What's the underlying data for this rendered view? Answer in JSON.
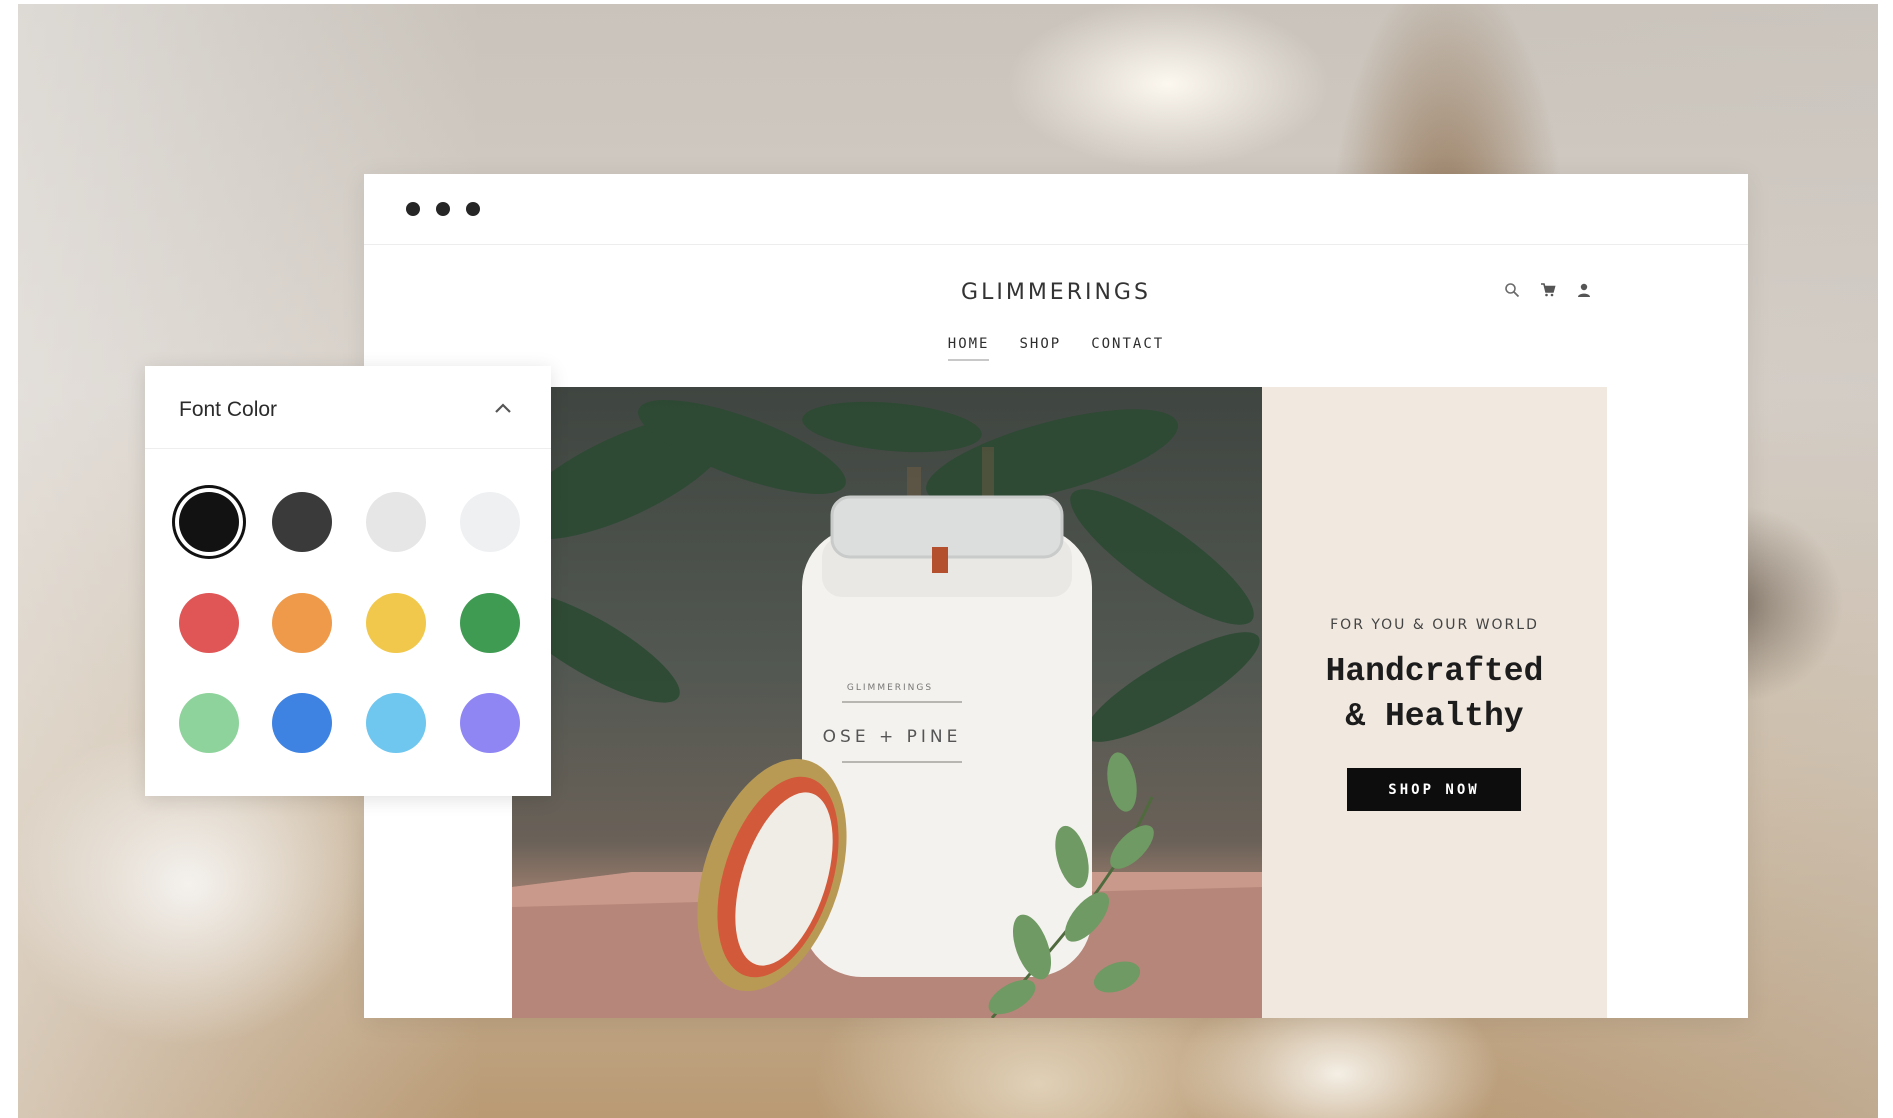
{
  "window": {
    "controls": [
      "dot",
      "dot",
      "dot"
    ]
  },
  "site": {
    "brand": "GLIMMERINGS",
    "header_icons": [
      "search-icon",
      "cart-icon",
      "user-icon"
    ],
    "nav": [
      {
        "label": "HOME",
        "active": true
      },
      {
        "label": "SHOP",
        "active": false
      },
      {
        "label": "CONTACT",
        "active": false
      }
    ]
  },
  "hero": {
    "jar_label_brand": "GLIMMERINGS",
    "jar_label_scent": "OSE + PINE",
    "kicker": "FOR YOU & OUR WORLD",
    "heading": "Handcrafted\n& Healthy",
    "cta_label": "SHOP NOW"
  },
  "font_color_panel": {
    "title": "Font Color",
    "collapse_icon": "chevron-up-icon",
    "selected_index": 0,
    "swatches": [
      {
        "name": "black",
        "color": "#121212"
      },
      {
        "name": "charcoal",
        "color": "#3a3a3b"
      },
      {
        "name": "light-gray",
        "color": "#e6e6e6"
      },
      {
        "name": "off-white",
        "color": "#eef0f2"
      },
      {
        "name": "red",
        "color": "#e05656"
      },
      {
        "name": "orange",
        "color": "#ee9a4a"
      },
      {
        "name": "yellow",
        "color": "#f1c84b"
      },
      {
        "name": "green",
        "color": "#3f9a52"
      },
      {
        "name": "mint",
        "color": "#8fd39c"
      },
      {
        "name": "blue",
        "color": "#3e82e2"
      },
      {
        "name": "sky",
        "color": "#6fc6ef"
      },
      {
        "name": "violet",
        "color": "#8f86f4"
      }
    ]
  }
}
